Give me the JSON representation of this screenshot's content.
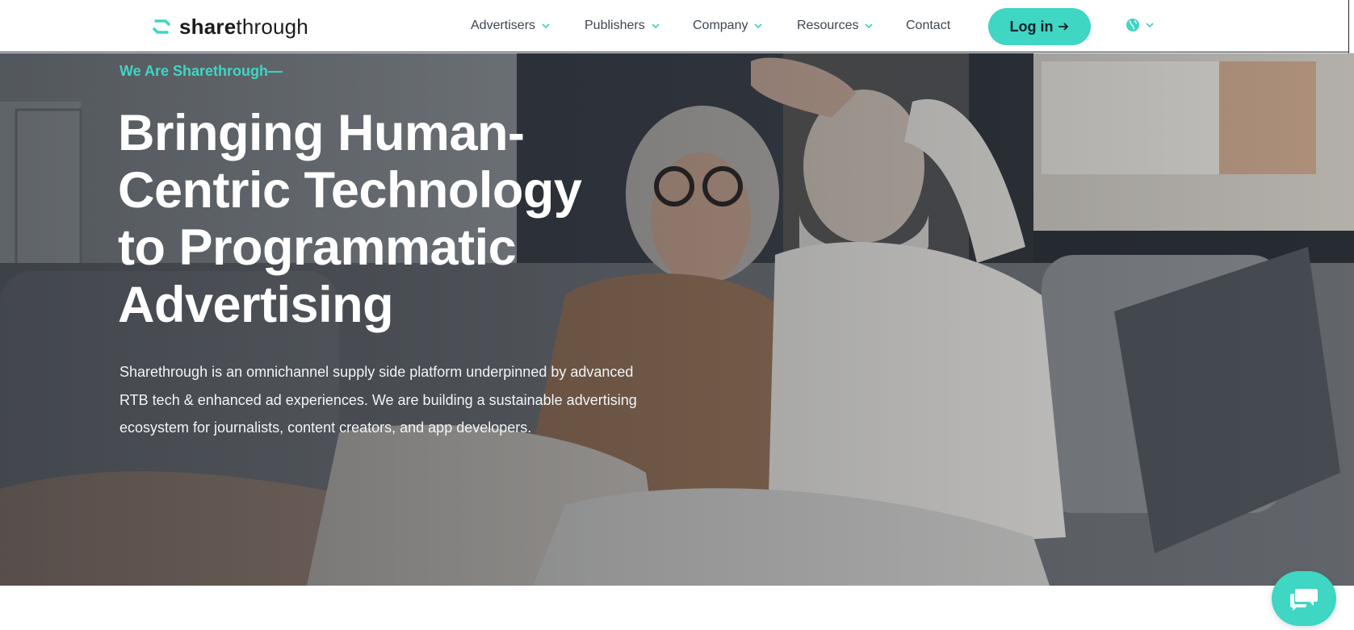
{
  "header": {
    "logo": {
      "text_bold": "share",
      "text_light": "through"
    },
    "nav": [
      {
        "label": "Advertisers",
        "has_dropdown": true
      },
      {
        "label": "Publishers",
        "has_dropdown": true
      },
      {
        "label": "Company",
        "has_dropdown": true
      },
      {
        "label": "Resources",
        "has_dropdown": true
      },
      {
        "label": "Contact",
        "has_dropdown": false
      }
    ],
    "login": {
      "label": "Log in",
      "icon": "arrow-right-icon"
    },
    "language": {
      "icon": "globe-icon"
    }
  },
  "hero": {
    "eyebrow": "We Are Sharethrough—",
    "headline": "Bringing Human-Centric Technology to Programmatic Advertising",
    "lede": "Sharethrough is an omnichannel supply side platform underpinned by advanced RTB tech & enhanced ad experiences. We are building a sustainable advertising ecosystem for journalists, content creators, and app developers."
  },
  "chat": {
    "icon": "chat-bubbles-icon"
  },
  "colors": {
    "accent": "#3fd6c3",
    "text_dark": "#1c1c1c",
    "nav_text": "#3d4650",
    "hero_text": "#ffffff"
  }
}
